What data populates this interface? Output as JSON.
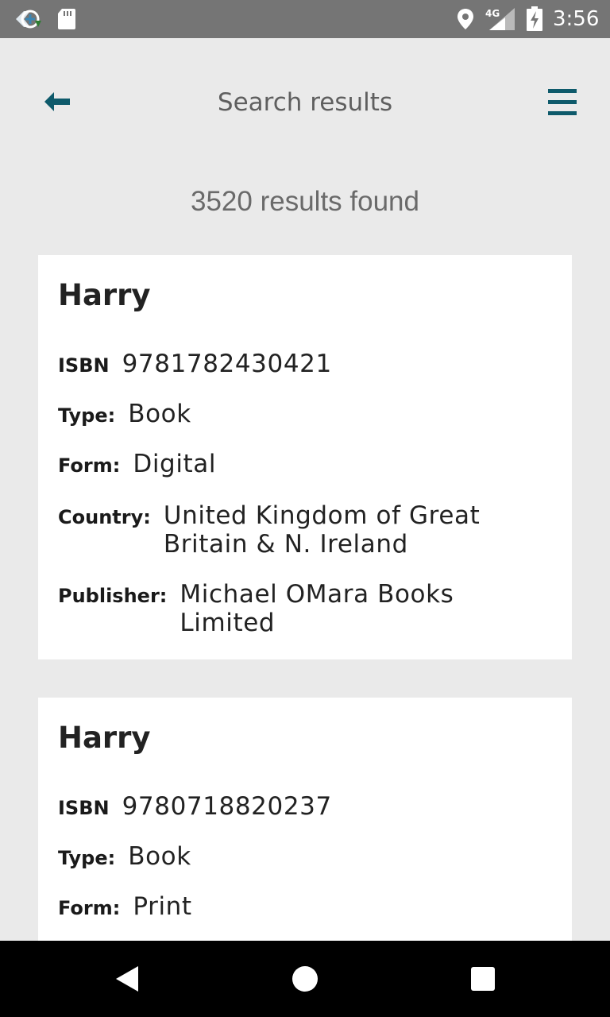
{
  "status_bar": {
    "time": "3:56",
    "network": "4G",
    "icons": [
      "app-notification-icon",
      "sd-card-icon",
      "location-icon",
      "signal-icon",
      "battery-charging-icon"
    ]
  },
  "header": {
    "title": "Search results",
    "back_icon": "arrow-left-icon",
    "menu_icon": "hamburger-menu-icon",
    "accent_color": "#0e5a6b"
  },
  "results": {
    "count_text": "3520 results found",
    "items": [
      {
        "title": "Harry",
        "isbn_label": "ISBN",
        "isbn": "9781782430421",
        "type_label": "Type:",
        "type": "Book",
        "form_label": "Form:",
        "form": "Digital",
        "country_label": "Country:",
        "country": "United Kingdom of Great Britain & N. Ireland",
        "publisher_label": "Publisher:",
        "publisher": "Michael OMara Books Limited"
      },
      {
        "title": "Harry",
        "isbn_label": "ISBN",
        "isbn": "9780718820237",
        "type_label": "Type:",
        "type": "Book",
        "form_label": "Form:",
        "form": "Print"
      }
    ]
  },
  "nav_bar": {
    "icons": [
      "nav-back-icon",
      "nav-home-icon",
      "nav-recents-icon"
    ]
  }
}
